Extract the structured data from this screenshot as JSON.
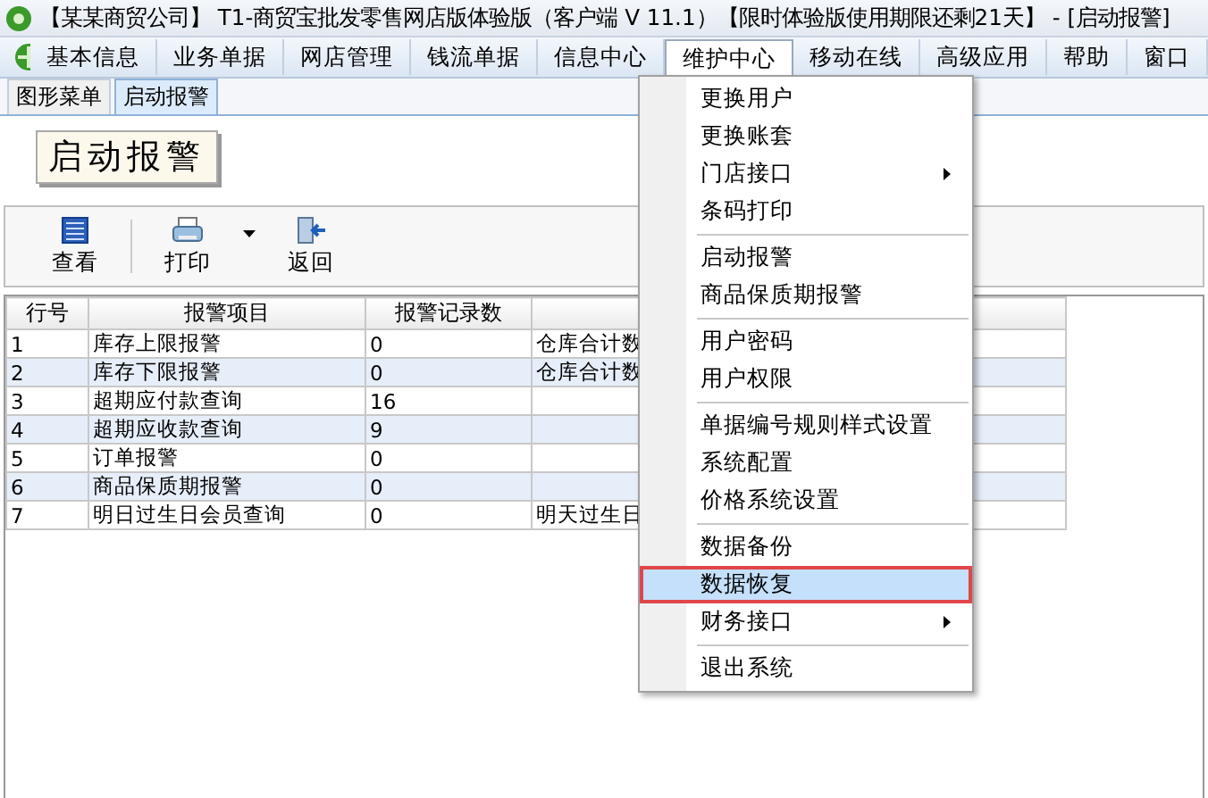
{
  "window": {
    "title": "【某某商贸公司】 T1-商贸宝批发零售网店版体验版（客户端 V 11.1）【限时体验版使用期限还剩21天】 - [启动报警]"
  },
  "menu_bar": [
    {
      "label": "基本信息",
      "selected": false
    },
    {
      "label": "业务单据",
      "selected": false
    },
    {
      "label": "网店管理",
      "selected": false
    },
    {
      "label": "钱流单据",
      "selected": false
    },
    {
      "label": "信息中心",
      "selected": false
    },
    {
      "label": "维护中心",
      "selected": true
    },
    {
      "label": "移动在线",
      "selected": false
    },
    {
      "label": "高级应用",
      "selected": false
    },
    {
      "label": "帮助",
      "selected": false
    },
    {
      "label": "窗口",
      "selected": false
    }
  ],
  "tabs": [
    {
      "label": "图形菜单",
      "selected": false
    },
    {
      "label": "启动报警",
      "selected": true
    }
  ],
  "banner": "启动报警",
  "toolbar": [
    {
      "kind": "view",
      "label": "查看"
    },
    {
      "kind": "print",
      "label": "打印"
    },
    {
      "kind": "back",
      "label": "返回"
    }
  ],
  "table": {
    "columns": [
      "行号",
      "报警项目",
      "报警记录数"
    ],
    "rows": [
      [
        "1",
        "库存上限报警",
        "0",
        "仓库合计数"
      ],
      [
        "2",
        "库存下限报警",
        "0",
        "仓库合计数"
      ],
      [
        "3",
        "超期应付款查询",
        "16",
        ""
      ],
      [
        "4",
        "超期应收款查询",
        "9",
        ""
      ],
      [
        "5",
        "订单报警",
        "0",
        ""
      ],
      [
        "6",
        "商品保质期报警",
        "0",
        ""
      ],
      [
        "7",
        "明日过生日会员查询",
        "0",
        "明天过生日"
      ]
    ]
  },
  "dropdown_menu": {
    "groups": [
      [
        {
          "label": "更换用户",
          "submenu": false,
          "selected": false
        },
        {
          "label": "更换账套",
          "submenu": false,
          "selected": false
        },
        {
          "label": "门店接口",
          "submenu": true,
          "selected": false
        },
        {
          "label": "条码打印",
          "submenu": false,
          "selected": false
        }
      ],
      [
        {
          "label": "启动报警",
          "submenu": false,
          "selected": false
        },
        {
          "label": "商品保质期报警",
          "submenu": false,
          "selected": false
        }
      ],
      [
        {
          "label": "用户密码",
          "submenu": false,
          "selected": false
        },
        {
          "label": "用户权限",
          "submenu": false,
          "selected": false
        }
      ],
      [
        {
          "label": "单据编号规则样式设置",
          "submenu": false,
          "selected": false
        },
        {
          "label": "系统配置",
          "submenu": false,
          "selected": false
        },
        {
          "label": "价格系统设置",
          "submenu": false,
          "selected": false
        }
      ],
      [
        {
          "label": "数据备份",
          "submenu": false,
          "selected": false
        },
        {
          "label": "数据恢复",
          "submenu": false,
          "selected": true
        },
        {
          "label": "财务接口",
          "submenu": true,
          "selected": false
        }
      ],
      [
        {
          "label": "退出系统",
          "submenu": false,
          "selected": false
        }
      ]
    ]
  }
}
